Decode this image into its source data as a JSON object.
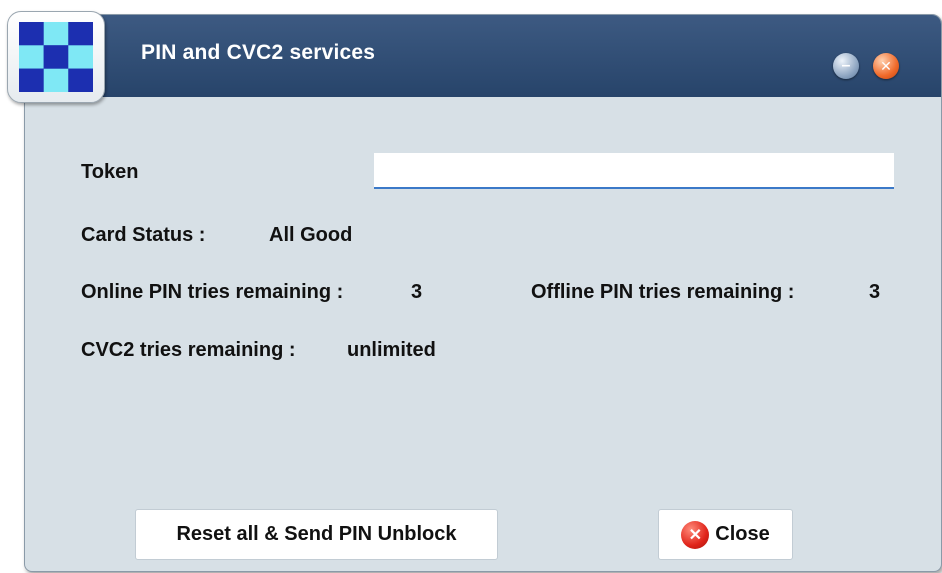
{
  "window": {
    "title": "PIN and CVC2 services",
    "minimize_glyph": "–",
    "close_glyph": "✕"
  },
  "icons": {
    "app": "checkerboard-app-icon",
    "minimize": "minimize-icon",
    "close_titlebar": "close-icon",
    "close_button": "close-icon"
  },
  "colors": {
    "titlebar": "#2f4b72",
    "body": "#d7e0e6",
    "input_underline": "#3b79c8",
    "close_red": "#e0241a"
  },
  "form": {
    "token_label": "Token",
    "token_value": "",
    "card_status_label": "Card Status :",
    "card_status_value": "All Good",
    "online_pin_label": "Online PIN tries remaining :",
    "online_pin_value": "3",
    "offline_pin_label": "Offline PIN tries remaining :",
    "offline_pin_value": "3",
    "cvc2_label": "CVC2 tries remaining :",
    "cvc2_value": "unlimited"
  },
  "buttons": {
    "reset_label": "Reset all & Send PIN Unblock",
    "close_label": "Close",
    "close_glyph": "✕"
  }
}
